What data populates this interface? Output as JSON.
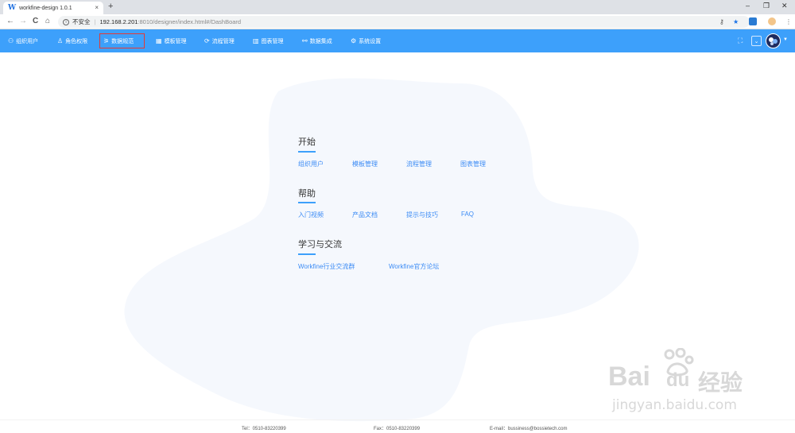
{
  "browser": {
    "tab_title": "workfine-design 1.0.1",
    "favicon_letter": "W",
    "tab_close": "×",
    "new_tab": "+",
    "insecure_label": "不安全",
    "url_host": "192.168.2.201",
    "url_path": ":8010/designer/index.html#/DashBoard",
    "nav_back": "←",
    "nav_forward": "→",
    "nav_reload": "C",
    "nav_home": "⌂",
    "key_icon": "⚷",
    "star_icon": "★",
    "menu_icon": "⋮",
    "window_minimize": "–",
    "window_restore": "❐",
    "window_close": "✕"
  },
  "appnav": {
    "items": [
      {
        "label": "组织用户",
        "icon": "org-icon",
        "glyph": "⚇"
      },
      {
        "label": "角色权限",
        "icon": "user-icon",
        "glyph": "♙"
      },
      {
        "label": "数据规范",
        "icon": "data-spec-icon",
        "glyph": "⚞"
      },
      {
        "label": "模板管理",
        "icon": "template-icon",
        "glyph": "▦"
      },
      {
        "label": "流程管理",
        "icon": "process-icon",
        "glyph": "⟳"
      },
      {
        "label": "图表管理",
        "icon": "chart-icon",
        "glyph": "▥"
      },
      {
        "label": "数据集成",
        "icon": "integration-icon",
        "glyph": "⚯"
      },
      {
        "label": "系统设置",
        "icon": "settings-icon",
        "glyph": "⚙"
      }
    ],
    "active_index": 2,
    "fullscreen_icon": "⛶",
    "dropdown_glyph": "⌄",
    "avatar_caret": "▼"
  },
  "dashboard": {
    "sections": [
      {
        "title": "开始",
        "links": [
          "组织用户",
          "模板管理",
          "流程管理",
          "图表管理"
        ]
      },
      {
        "title": "帮助",
        "links": [
          "入门视频",
          "产品文档",
          "提示与技巧",
          "FAQ"
        ]
      },
      {
        "title": "学习与交流",
        "links": [
          "Workfine行业交流群",
          "Workfine官方论坛"
        ]
      }
    ]
  },
  "footer": {
    "tel": "Tel：0510-83220399",
    "fax": "Fax：0510-83220399",
    "email": "E-mail：bussiness@bossietech.com"
  },
  "watermark": {
    "brand": "Bai",
    "brand2": "du",
    "cn": "经验",
    "url": "jingyan.baidu.com"
  },
  "colors": {
    "appbar": "#3da0fb",
    "link": "#3d8cf5",
    "active_border": "#e53935",
    "blob": "#f5f8fd"
  }
}
